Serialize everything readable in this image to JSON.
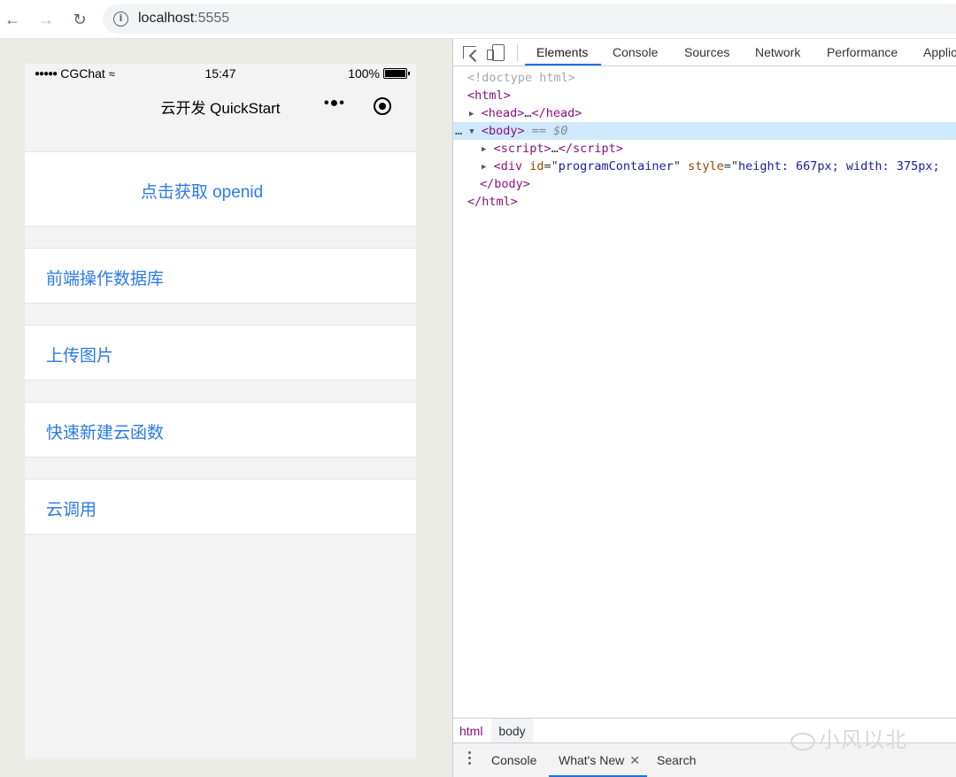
{
  "browser": {
    "url_host": "localhost",
    "url_port": ":5555"
  },
  "simulator": {
    "statusbar": {
      "carrier_dots": "●●●●●",
      "carrier": "CGChat",
      "time": "15:47",
      "battery": "100%"
    },
    "navbar": {
      "title": "云开发 QuickStart",
      "menu_dots": "•●•"
    },
    "openid_button": "点击获取 openid",
    "rows": [
      "前端操作数据库",
      "上传图片",
      "快速新建云函数",
      "云调用"
    ]
  },
  "devtools": {
    "tabs": [
      "Elements",
      "Console",
      "Sources",
      "Network",
      "Performance",
      "Applic"
    ],
    "active_tab": "Elements",
    "dom": {
      "doctype": "<!doctype html>",
      "html_open": "<html>",
      "head": "head",
      "body": "body",
      "body_marker": "== $0",
      "script": "script",
      "div_tag": "div",
      "div_attr_id": "id",
      "div_id_value": "programContainer",
      "div_attr_style": "style",
      "div_style_value": "height: 667px; width: 375px;",
      "body_close": "</body>",
      "html_close": "</html>"
    },
    "breadcrumbs": [
      "html",
      "body"
    ],
    "drawer_tabs": [
      "Console",
      "What's New",
      "Search"
    ],
    "drawer_active": "What's New"
  },
  "watermark": "小风以北",
  "colors": {
    "link_blue": "#2b7ae8",
    "devtools_accent": "#1a73e8",
    "selected_row": "#cfe8fc"
  }
}
